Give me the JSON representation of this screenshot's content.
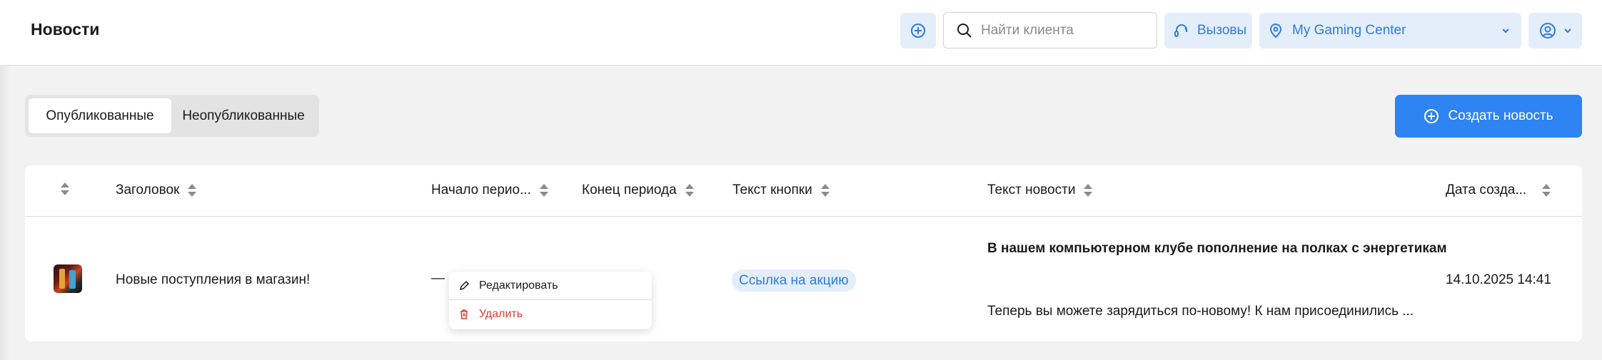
{
  "header": {
    "title": "Новости",
    "search_placeholder": "Найти клиента",
    "calls_label": "Вызовы",
    "club_label": "My Gaming Center"
  },
  "tabs": [
    {
      "label": "Опубликованные",
      "active": true
    },
    {
      "label": "Неопубликованные",
      "active": false
    }
  ],
  "create_button_label": "Создать новость",
  "table": {
    "columns": [
      "",
      "Заголовок",
      "Начало перио...",
      "Конец периода",
      "Текст кнопки",
      "Текст новости",
      "Дата созда..."
    ],
    "rows": [
      {
        "title": "Новые поступления в магазин!",
        "start": "—",
        "end": "",
        "button_text": "Ссылка на акцию",
        "news_title": "В нашем компьютерном клубе пополнение на полках с энергетикам",
        "news_text": "Теперь вы можете зарядиться по-новому! К нам присоединились ...",
        "created": "14.10.2025 14:41"
      }
    ]
  },
  "context_menu": {
    "edit_label": "Редактировать",
    "delete_label": "Удалить"
  },
  "colors": {
    "accent": "#2d84f2",
    "accent_light": "#e4eefb",
    "danger": "#e53935",
    "background": "#f2f2f2"
  },
  "icons": [
    "plus-circle-icon",
    "search-icon",
    "headset-icon",
    "location-pin-icon",
    "chevron-down-icon",
    "user-icon",
    "sort-icon",
    "pencil-icon",
    "trash-icon"
  ]
}
